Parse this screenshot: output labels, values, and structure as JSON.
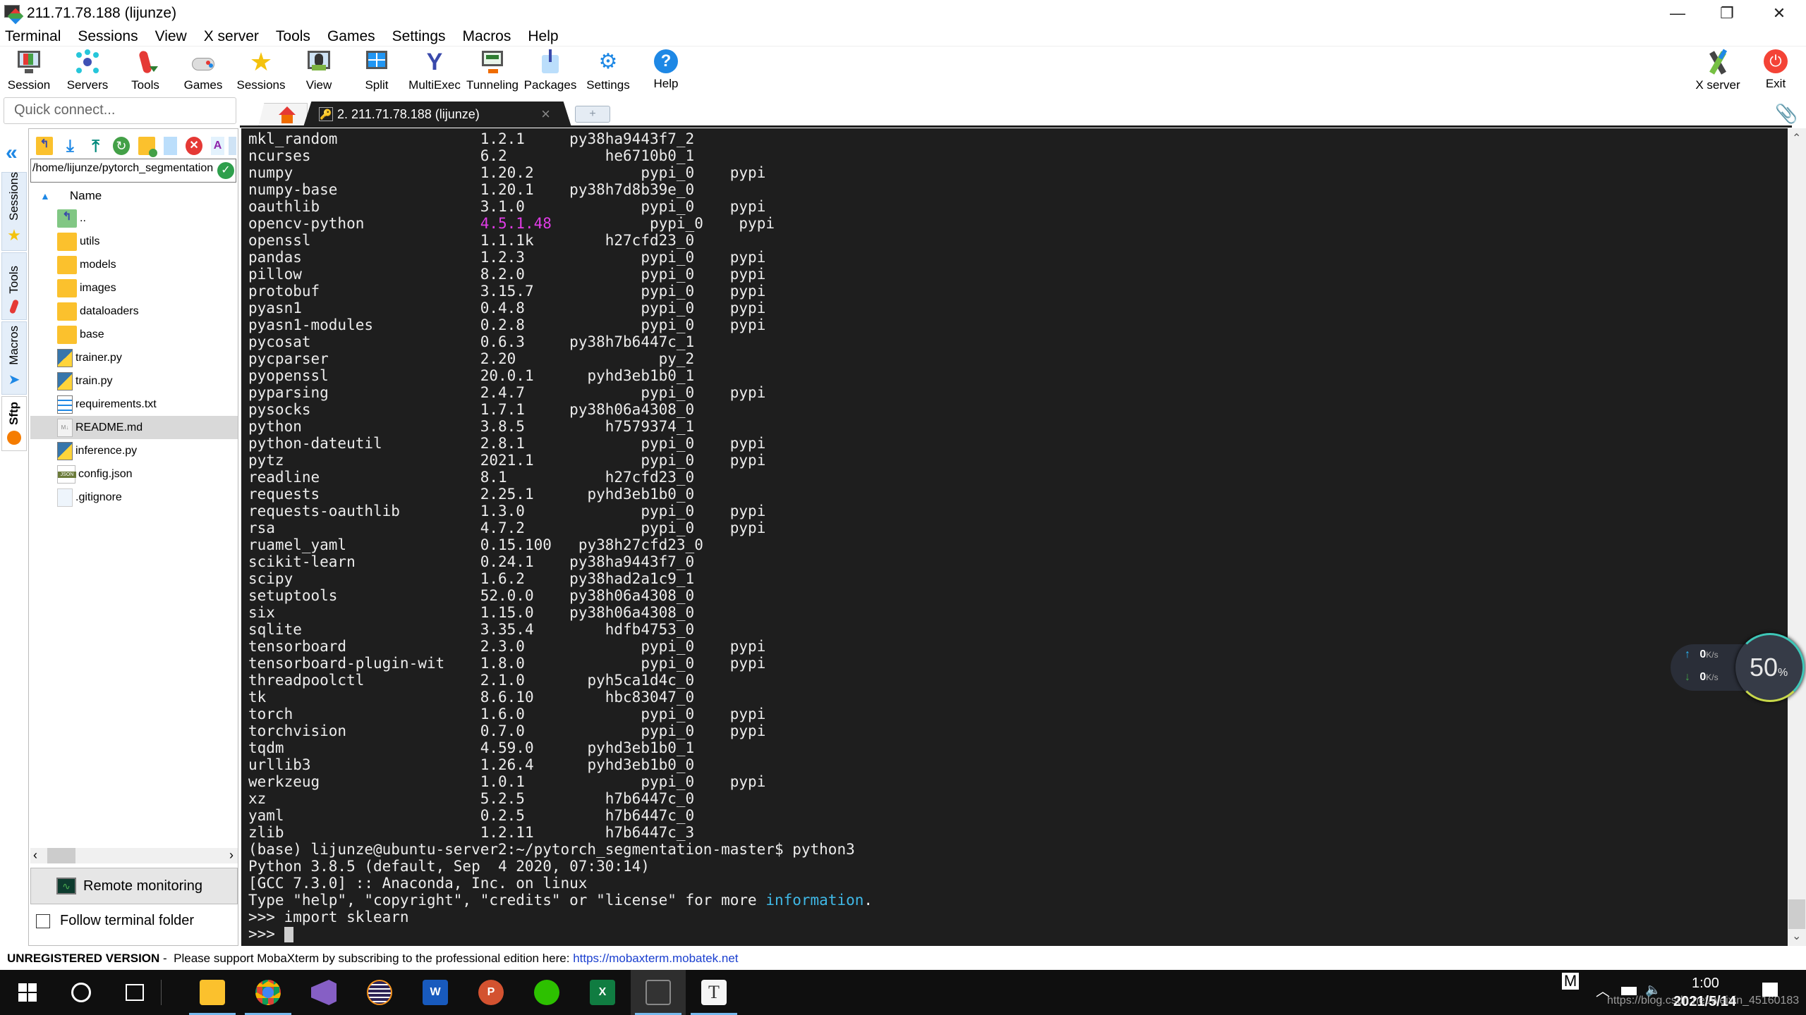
{
  "window": {
    "title": "211.71.78.188 (lijunze)",
    "controls": {
      "minimize": "—",
      "restore": "❐",
      "close": "✕"
    }
  },
  "menubar": [
    "Terminal",
    "Sessions",
    "View",
    "X server",
    "Tools",
    "Games",
    "Settings",
    "Macros",
    "Help"
  ],
  "toolbar": {
    "left": [
      {
        "label": "Session",
        "icon": "session-icon"
      },
      {
        "label": "Servers",
        "icon": "servers-icon"
      },
      {
        "label": "Tools",
        "icon": "tools-icon"
      },
      {
        "label": "Games",
        "icon": "gamepad-icon"
      },
      {
        "label": "Sessions",
        "icon": "star-icon"
      },
      {
        "label": "View",
        "icon": "view-icon"
      },
      {
        "label": "Split",
        "icon": "split-icon"
      },
      {
        "label": "MultiExec",
        "icon": "multiexec-icon"
      },
      {
        "label": "Tunneling",
        "icon": "tunneling-icon"
      },
      {
        "label": "Packages",
        "icon": "packages-icon"
      },
      {
        "label": "Settings",
        "icon": "gears-icon"
      },
      {
        "label": "Help",
        "icon": "help-icon"
      }
    ],
    "right": [
      {
        "label": "X server",
        "icon": "xserver-icon"
      },
      {
        "label": "Exit",
        "icon": "power-icon"
      }
    ]
  },
  "quick_connect": {
    "placeholder": "Quick connect..."
  },
  "tabs": {
    "home": "home-icon",
    "active": {
      "label": "2. 211.71.78.188 (lijunze)",
      "close": "×"
    },
    "new_tab": "+"
  },
  "side_tabs": [
    "Sessions",
    "Tools",
    "Macros",
    "Sftp"
  ],
  "sftp": {
    "path": "/home/lijunze/pytorch_segmentation",
    "column_header": "Name",
    "files": [
      {
        "name": "..",
        "type": "parent"
      },
      {
        "name": "utils",
        "type": "folder"
      },
      {
        "name": "models",
        "type": "folder"
      },
      {
        "name": "images",
        "type": "folder"
      },
      {
        "name": "dataloaders",
        "type": "folder"
      },
      {
        "name": "base",
        "type": "folder"
      },
      {
        "name": "trainer.py",
        "type": "python"
      },
      {
        "name": "train.py",
        "type": "python"
      },
      {
        "name": "requirements.txt",
        "type": "text"
      },
      {
        "name": "README.md",
        "type": "markdown",
        "selected": true
      },
      {
        "name": "inference.py",
        "type": "python"
      },
      {
        "name": "config.json",
        "type": "json"
      },
      {
        "name": ".gitignore",
        "type": "file"
      }
    ],
    "remote_monitoring": "Remote monitoring",
    "follow_terminal_folder": {
      "label": "Follow terminal folder",
      "checked": false
    }
  },
  "terminal": {
    "packages": [
      [
        "mkl_random",
        "1.2.1",
        "py38ha9443f7_2",
        ""
      ],
      [
        "ncurses",
        "6.2",
        "he6710b0_1",
        ""
      ],
      [
        "numpy",
        "1.20.2",
        "pypi_0",
        "pypi"
      ],
      [
        "numpy-base",
        "1.20.1",
        "py38h7d8b39e_0",
        ""
      ],
      [
        "oauthlib",
        "3.1.0",
        "pypi_0",
        "pypi"
      ],
      [
        "opencv-python",
        "4.5.1.48",
        "pypi_0",
        "pypi"
      ],
      [
        "openssl",
        "1.1.1k",
        "h27cfd23_0",
        ""
      ],
      [
        "pandas",
        "1.2.3",
        "pypi_0",
        "pypi"
      ],
      [
        "pillow",
        "8.2.0",
        "pypi_0",
        "pypi"
      ],
      [
        "protobuf",
        "3.15.7",
        "pypi_0",
        "pypi"
      ],
      [
        "pyasn1",
        "0.4.8",
        "pypi_0",
        "pypi"
      ],
      [
        "pyasn1-modules",
        "0.2.8",
        "pypi_0",
        "pypi"
      ],
      [
        "pycosat",
        "0.6.3",
        "py38h7b6447c_1",
        ""
      ],
      [
        "pycparser",
        "2.20",
        "py_2",
        ""
      ],
      [
        "pyopenssl",
        "20.0.1",
        "pyhd3eb1b0_1",
        ""
      ],
      [
        "pyparsing",
        "2.4.7",
        "pypi_0",
        "pypi"
      ],
      [
        "pysocks",
        "1.7.1",
        "py38h06a4308_0",
        ""
      ],
      [
        "python",
        "3.8.5",
        "h7579374_1",
        ""
      ],
      [
        "python-dateutil",
        "2.8.1",
        "pypi_0",
        "pypi"
      ],
      [
        "pytz",
        "2021.1",
        "pypi_0",
        "pypi"
      ],
      [
        "readline",
        "8.1",
        "h27cfd23_0",
        ""
      ],
      [
        "requests",
        "2.25.1",
        "pyhd3eb1b0_0",
        ""
      ],
      [
        "requests-oauthlib",
        "1.3.0",
        "pypi_0",
        "pypi"
      ],
      [
        "rsa",
        "4.7.2",
        "pypi_0",
        "pypi"
      ],
      [
        "ruamel_yaml",
        "0.15.100",
        "py38h27cfd23_0",
        ""
      ],
      [
        "scikit-learn",
        "0.24.1",
        "py38ha9443f7_0",
        ""
      ],
      [
        "scipy",
        "1.6.2",
        "py38had2a1c9_1",
        ""
      ],
      [
        "setuptools",
        "52.0.0",
        "py38h06a4308_0",
        ""
      ],
      [
        "six",
        "1.15.0",
        "py38h06a4308_0",
        ""
      ],
      [
        "sqlite",
        "3.35.4",
        "hdfb4753_0",
        ""
      ],
      [
        "tensorboard",
        "2.3.0",
        "pypi_0",
        "pypi"
      ],
      [
        "tensorboard-plugin-wit",
        "1.8.0",
        "pypi_0",
        "pypi"
      ],
      [
        "threadpoolctl",
        "2.1.0",
        "pyh5ca1d4c_0",
        ""
      ],
      [
        "tk",
        "8.6.10",
        "hbc83047_0",
        ""
      ],
      [
        "torch",
        "1.6.0",
        "pypi_0",
        "pypi"
      ],
      [
        "torchvision",
        "0.7.0",
        "pypi_0",
        "pypi"
      ],
      [
        "tqdm",
        "4.59.0",
        "pyhd3eb1b0_1",
        ""
      ],
      [
        "urllib3",
        "1.26.4",
        "pyhd3eb1b0_0",
        ""
      ],
      [
        "werkzeug",
        "1.0.1",
        "pypi_0",
        "pypi"
      ],
      [
        "xz",
        "5.2.5",
        "h7b6447c_0",
        ""
      ],
      [
        "yaml",
        "0.2.5",
        "h7b6447c_0",
        ""
      ],
      [
        "zlib",
        "1.2.11",
        "h7b6447c_3",
        ""
      ]
    ],
    "highlight_version": "4.5.1.48",
    "prompt_line": "(base) lijunze@ubuntu-server2:~/pytorch_segmentation-master$ python3",
    "python_banner": "Python 3.8.5 (default, Sep  4 2020, 07:30:14)",
    "gcc_line": "[GCC 7.3.0] :: Anaconda, Inc. on linux",
    "type_help_prefix": "Type \"help\", \"copyright\", \"credits\" or \"license\" for more ",
    "type_help_link": "information",
    "type_help_suffix": ".",
    "import_line": ">>> import sklearn",
    "current_prompt": ">>> "
  },
  "net_widget": {
    "upload": "0",
    "download": "0",
    "unit": "K/s",
    "percent": "50",
    "percent_sign": "%",
    "percent_value": 50
  },
  "statusbar": {
    "unregistered": "UNREGISTERED VERSION",
    "message": " -  Please support MobaXterm by subscribing to the professional edition here: ",
    "link": "https://mobaxterm.mobatek.net"
  },
  "taskbar": {
    "apps": [
      "start",
      "cortana",
      "task-view",
      "file-explorer",
      "chrome",
      "visual-studio",
      "eclipse",
      "word",
      "powerpoint",
      "wechat",
      "excel",
      "mobaxterm",
      "typora"
    ],
    "time": "1:00",
    "date": "2021/5/14",
    "watermark": "https://blog.csdn.net/weixin_45160183",
    "ime": "M"
  },
  "colors": {
    "terminal_bg": "#1e1e1e",
    "terminal_fg": "#ececec",
    "highlight": "#e03ce6",
    "link": "#3fb8e6",
    "accent": "#1e88e5"
  }
}
